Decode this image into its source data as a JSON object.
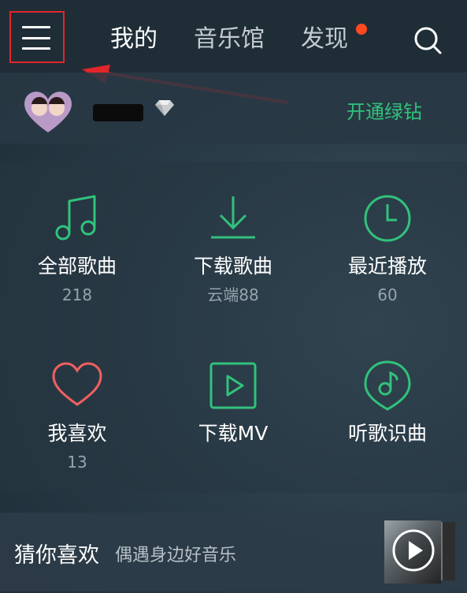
{
  "header": {
    "tabs": [
      {
        "label": "我的"
      },
      {
        "label": "音乐馆"
      },
      {
        "label": "发现"
      }
    ],
    "active_tab": "我的",
    "accent_color": "#31c27c",
    "dot_color": "#ff4a1f"
  },
  "user": {
    "name": "****",
    "vip_link": "开通绿钻"
  },
  "grid": [
    {
      "label": "全部歌曲",
      "sub": "218",
      "icon": "music-note-icon"
    },
    {
      "label": "下载歌曲",
      "sub": "云端88",
      "icon": "download-icon"
    },
    {
      "label": "最近播放",
      "sub": "60",
      "icon": "clock-icon"
    },
    {
      "label": "我喜欢",
      "sub": "13",
      "icon": "heart-icon"
    },
    {
      "label": "下载MV",
      "sub": "",
      "icon": "play-box-icon"
    },
    {
      "label": "听歌识曲",
      "sub": "",
      "icon": "music-recognition-icon"
    }
  ],
  "guess": {
    "title": "猜你喜欢",
    "subtitle": "偶遇身边好音乐"
  }
}
